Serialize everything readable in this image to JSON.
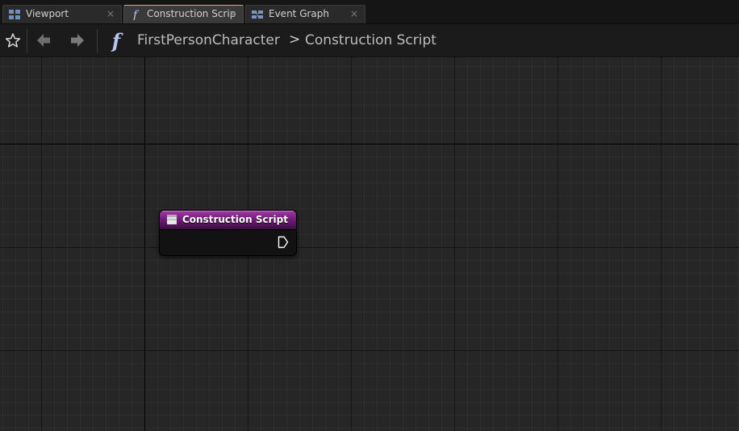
{
  "tabs": [
    {
      "label": "Viewport",
      "icon": "viewport-icon",
      "close": "×",
      "active": false
    },
    {
      "label": "Construction Scrip",
      "icon": "function-icon",
      "close": "×",
      "active": true
    },
    {
      "label": "Event Graph",
      "icon": "event-graph-icon",
      "close": "×",
      "active": false
    }
  ],
  "toolbar": {
    "function_glyph": "f",
    "breadcrumb": {
      "root": "FirstPersonCharacter",
      "separator": ">",
      "current": "Construction Script"
    }
  },
  "node": {
    "title": "Construction Script",
    "header_color": "#7a1f80",
    "icon": "construction-script-icon"
  },
  "colors": {
    "canvas_bg": "#262626",
    "active_tab_accent": "#d2b04a",
    "node_header": "#a33ba8"
  }
}
